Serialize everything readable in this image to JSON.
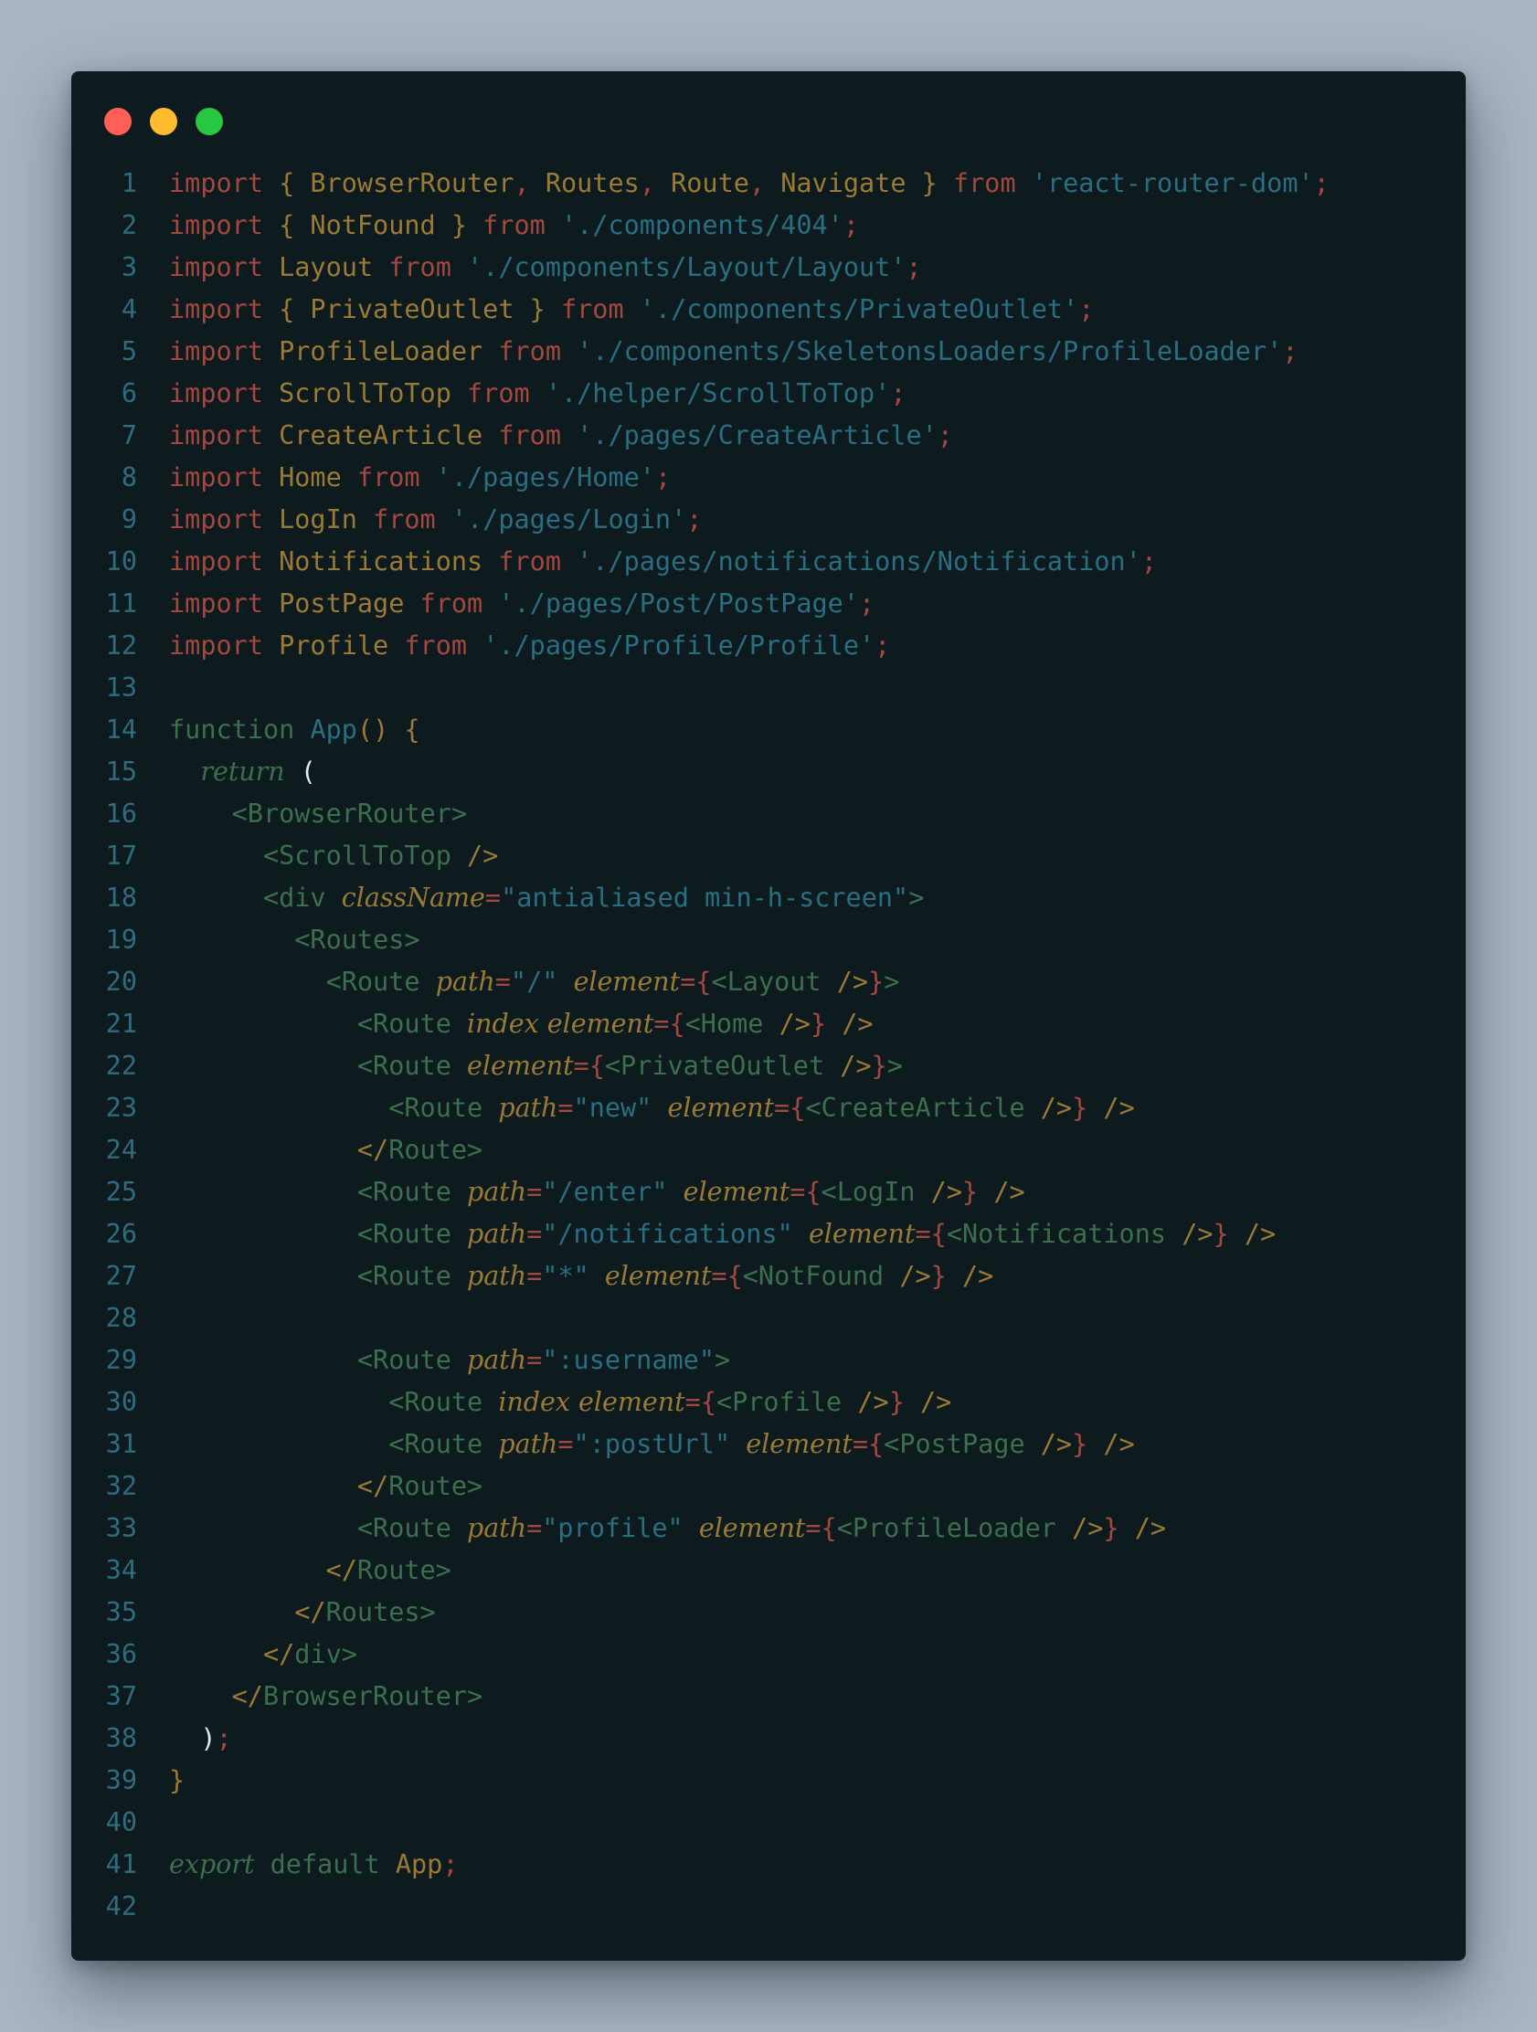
{
  "window": {
    "traffic_lights": {
      "close_color": "#ff5f57",
      "minimize_color": "#febc2e",
      "maximize_color": "#28c840"
    }
  },
  "code": {
    "lines": [
      {
        "num": "1",
        "tokens": [
          [
            "kw",
            "import"
          ],
          [
            "id",
            " { BrowserRouter"
          ],
          [
            "pun",
            ","
          ],
          [
            "id",
            " Routes"
          ],
          [
            "pun",
            ","
          ],
          [
            "id",
            " Route"
          ],
          [
            "pun",
            ","
          ],
          [
            "id",
            " Navigate } "
          ],
          [
            "kw",
            "from"
          ],
          [
            "str",
            " 'react-router-dom'"
          ],
          [
            "pun",
            ";"
          ]
        ]
      },
      {
        "num": "2",
        "tokens": [
          [
            "kw",
            "import"
          ],
          [
            "id",
            " { NotFound } "
          ],
          [
            "kw",
            "from"
          ],
          [
            "str",
            " './components/404'"
          ],
          [
            "pun",
            ";"
          ]
        ]
      },
      {
        "num": "3",
        "tokens": [
          [
            "kw",
            "import"
          ],
          [
            "id",
            " Layout "
          ],
          [
            "kw",
            "from"
          ],
          [
            "str",
            " './components/Layout/Layout'"
          ],
          [
            "pun",
            ";"
          ]
        ]
      },
      {
        "num": "4",
        "tokens": [
          [
            "kw",
            "import"
          ],
          [
            "id",
            " { PrivateOutlet } "
          ],
          [
            "kw",
            "from"
          ],
          [
            "str",
            " './components/PrivateOutlet'"
          ],
          [
            "pun",
            ";"
          ]
        ]
      },
      {
        "num": "5",
        "tokens": [
          [
            "kw",
            "import"
          ],
          [
            "id",
            " ProfileLoader "
          ],
          [
            "kw",
            "from"
          ],
          [
            "str",
            " './components/SkeletonsLoaders/ProfileLoader'"
          ],
          [
            "pun",
            ";"
          ]
        ]
      },
      {
        "num": "6",
        "tokens": [
          [
            "kw",
            "import"
          ],
          [
            "id",
            " ScrollToTop "
          ],
          [
            "kw",
            "from"
          ],
          [
            "str",
            " './helper/ScrollToTop'"
          ],
          [
            "pun",
            ";"
          ]
        ]
      },
      {
        "num": "7",
        "tokens": [
          [
            "kw",
            "import"
          ],
          [
            "id",
            " CreateArticle "
          ],
          [
            "kw",
            "from"
          ],
          [
            "str",
            " './pages/CreateArticle'"
          ],
          [
            "pun",
            ";"
          ]
        ]
      },
      {
        "num": "8",
        "tokens": [
          [
            "kw",
            "import"
          ],
          [
            "id",
            " Home "
          ],
          [
            "kw",
            "from"
          ],
          [
            "str",
            " './pages/Home'"
          ],
          [
            "pun",
            ";"
          ]
        ]
      },
      {
        "num": "9",
        "tokens": [
          [
            "kw",
            "import"
          ],
          [
            "id",
            " LogIn "
          ],
          [
            "kw",
            "from"
          ],
          [
            "str",
            " './pages/Login'"
          ],
          [
            "pun",
            ";"
          ]
        ]
      },
      {
        "num": "10",
        "tokens": [
          [
            "kw",
            "import"
          ],
          [
            "id",
            " Notifications "
          ],
          [
            "kw",
            "from"
          ],
          [
            "str",
            " './pages/notifications/Notification'"
          ],
          [
            "pun",
            ";"
          ]
        ]
      },
      {
        "num": "11",
        "tokens": [
          [
            "kw",
            "import"
          ],
          [
            "id",
            " PostPage "
          ],
          [
            "kw",
            "from"
          ],
          [
            "str",
            " './pages/Post/PostPage'"
          ],
          [
            "pun",
            ";"
          ]
        ]
      },
      {
        "num": "12",
        "tokens": [
          [
            "kw",
            "import"
          ],
          [
            "id",
            " Profile "
          ],
          [
            "kw",
            "from"
          ],
          [
            "str",
            " './pages/Profile/Profile'"
          ],
          [
            "pun",
            ";"
          ]
        ]
      },
      {
        "num": "13",
        "tokens": []
      },
      {
        "num": "14",
        "tokens": [
          [
            "fn",
            "function"
          ],
          [
            "fnn",
            " App"
          ],
          [
            "br",
            "() {"
          ]
        ]
      },
      {
        "num": "15",
        "tokens": [
          [
            "plain",
            "  "
          ],
          [
            "ret",
            "return"
          ],
          [
            "paren",
            " ("
          ]
        ]
      },
      {
        "num": "16",
        "tokens": [
          [
            "tag",
            "    <BrowserRouter>"
          ]
        ]
      },
      {
        "num": "17",
        "tokens": [
          [
            "tag",
            "      <ScrollToTop "
          ],
          [
            "tagp",
            "/>"
          ]
        ]
      },
      {
        "num": "18",
        "tokens": [
          [
            "tag",
            "      <div "
          ],
          [
            "attr",
            "className"
          ],
          [
            "eq",
            "="
          ],
          [
            "val",
            "\"antialiased min-h-screen\""
          ],
          [
            "tag",
            ">"
          ]
        ]
      },
      {
        "num": "19",
        "tokens": [
          [
            "tag",
            "        <Routes>"
          ]
        ]
      },
      {
        "num": "20",
        "tokens": [
          [
            "tag",
            "          <Route "
          ],
          [
            "attr",
            "path"
          ],
          [
            "eq",
            "="
          ],
          [
            "val",
            "\"/\" "
          ],
          [
            "attr",
            "element"
          ],
          [
            "eq",
            "={"
          ],
          [
            "tag",
            "<Layout "
          ],
          [
            "tagp",
            "/>"
          ],
          [
            "eq",
            "}"
          ],
          [
            "tag",
            ">"
          ]
        ]
      },
      {
        "num": "21",
        "tokens": [
          [
            "tag",
            "            <Route "
          ],
          [
            "attr",
            "index element"
          ],
          [
            "eq",
            "={"
          ],
          [
            "tag",
            "<Home "
          ],
          [
            "tagp",
            "/>"
          ],
          [
            "eq",
            "}"
          ],
          [
            "tagp",
            " />"
          ]
        ]
      },
      {
        "num": "22",
        "tokens": [
          [
            "tag",
            "            <Route "
          ],
          [
            "attr",
            "element"
          ],
          [
            "eq",
            "={"
          ],
          [
            "tag",
            "<PrivateOutlet "
          ],
          [
            "tagp",
            "/>"
          ],
          [
            "eq",
            "}"
          ],
          [
            "tag",
            ">"
          ]
        ]
      },
      {
        "num": "23",
        "tokens": [
          [
            "tag",
            "              <Route "
          ],
          [
            "attr",
            "path"
          ],
          [
            "eq",
            "="
          ],
          [
            "val",
            "\"new\" "
          ],
          [
            "attr",
            "element"
          ],
          [
            "eq",
            "={"
          ],
          [
            "tag",
            "<CreateArticle "
          ],
          [
            "tagp",
            "/>"
          ],
          [
            "eq",
            "}"
          ],
          [
            "tagp",
            " />"
          ]
        ]
      },
      {
        "num": "24",
        "tokens": [
          [
            "tagp",
            "            </"
          ],
          [
            "tag",
            "Route>"
          ]
        ]
      },
      {
        "num": "25",
        "tokens": [
          [
            "tag",
            "            <Route "
          ],
          [
            "attr",
            "path"
          ],
          [
            "eq",
            "="
          ],
          [
            "val",
            "\"/enter\" "
          ],
          [
            "attr",
            "element"
          ],
          [
            "eq",
            "={"
          ],
          [
            "tag",
            "<LogIn "
          ],
          [
            "tagp",
            "/>"
          ],
          [
            "eq",
            "}"
          ],
          [
            "tagp",
            " />"
          ]
        ]
      },
      {
        "num": "26",
        "tokens": [
          [
            "tag",
            "            <Route "
          ],
          [
            "attr",
            "path"
          ],
          [
            "eq",
            "="
          ],
          [
            "val",
            "\"/notifications\" "
          ],
          [
            "attr",
            "element"
          ],
          [
            "eq",
            "={"
          ],
          [
            "tag",
            "<Notifications "
          ],
          [
            "tagp",
            "/>"
          ],
          [
            "eq",
            "}"
          ],
          [
            "tagp",
            " />"
          ]
        ]
      },
      {
        "num": "27",
        "tokens": [
          [
            "tag",
            "            <Route "
          ],
          [
            "attr",
            "path"
          ],
          [
            "eq",
            "="
          ],
          [
            "val",
            "\"*\" "
          ],
          [
            "attr",
            "element"
          ],
          [
            "eq",
            "={"
          ],
          [
            "tag",
            "<NotFound "
          ],
          [
            "tagp",
            "/>"
          ],
          [
            "eq",
            "}"
          ],
          [
            "tagp",
            " />"
          ]
        ]
      },
      {
        "num": "28",
        "tokens": []
      },
      {
        "num": "29",
        "tokens": [
          [
            "tag",
            "            <Route "
          ],
          [
            "attr",
            "path"
          ],
          [
            "eq",
            "="
          ],
          [
            "val",
            "\":username\""
          ],
          [
            "tag",
            ">"
          ]
        ]
      },
      {
        "num": "30",
        "tokens": [
          [
            "tag",
            "              <Route "
          ],
          [
            "attr",
            "index element"
          ],
          [
            "eq",
            "={"
          ],
          [
            "tag",
            "<Profile "
          ],
          [
            "tagp",
            "/>"
          ],
          [
            "eq",
            "}"
          ],
          [
            "tagp",
            " />"
          ]
        ]
      },
      {
        "num": "31",
        "tokens": [
          [
            "tag",
            "              <Route "
          ],
          [
            "attr",
            "path"
          ],
          [
            "eq",
            "="
          ],
          [
            "val",
            "\":postUrl\" "
          ],
          [
            "attr",
            "element"
          ],
          [
            "eq",
            "={"
          ],
          [
            "tag",
            "<PostPage "
          ],
          [
            "tagp",
            "/>"
          ],
          [
            "eq",
            "}"
          ],
          [
            "tagp",
            " />"
          ]
        ]
      },
      {
        "num": "32",
        "tokens": [
          [
            "tagp",
            "            </"
          ],
          [
            "tag",
            "Route>"
          ]
        ]
      },
      {
        "num": "33",
        "tokens": [
          [
            "tag",
            "            <Route "
          ],
          [
            "attr",
            "path"
          ],
          [
            "eq",
            "="
          ],
          [
            "val",
            "\"profile\" "
          ],
          [
            "attr",
            "element"
          ],
          [
            "eq",
            "={"
          ],
          [
            "tag",
            "<ProfileLoader "
          ],
          [
            "tagp",
            "/>"
          ],
          [
            "eq",
            "}"
          ],
          [
            "tagp",
            " />"
          ]
        ]
      },
      {
        "num": "34",
        "tokens": [
          [
            "tagp",
            "          </"
          ],
          [
            "tag",
            "Route>"
          ]
        ]
      },
      {
        "num": "35",
        "tokens": [
          [
            "tagp",
            "        </"
          ],
          [
            "tag",
            "Routes>"
          ]
        ]
      },
      {
        "num": "36",
        "tokens": [
          [
            "tagp",
            "      </"
          ],
          [
            "tag",
            "div>"
          ]
        ]
      },
      {
        "num": "37",
        "tokens": [
          [
            "tagp",
            "    </"
          ],
          [
            "tag",
            "BrowserRouter>"
          ]
        ]
      },
      {
        "num": "38",
        "tokens": [
          [
            "plain",
            "  "
          ],
          [
            "paren",
            ")"
          ],
          [
            "pun",
            ";"
          ]
        ]
      },
      {
        "num": "39",
        "tokens": [
          [
            "br",
            "}"
          ]
        ]
      },
      {
        "num": "40",
        "tokens": []
      },
      {
        "num": "41",
        "tokens": [
          [
            "exp",
            "export"
          ],
          [
            "plain",
            " default "
          ],
          [
            "id",
            "App"
          ],
          [
            "pun",
            ";"
          ]
        ]
      },
      {
        "num": "42",
        "tokens": []
      }
    ]
  }
}
